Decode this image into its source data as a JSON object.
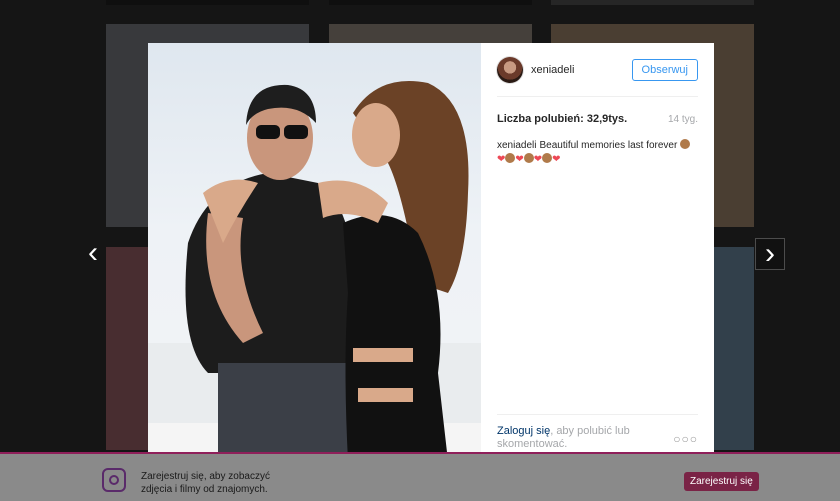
{
  "modal": {
    "username": "xeniadeli",
    "follow_label": "Obserwuj",
    "likes_label": "Liczba polubień: 32,9tys.",
    "time_label": "14 tyg.",
    "caption_user": "xeniadeli",
    "caption_text": "Beautiful memories last forever",
    "caption_emojis": [
      "see-no-evil-monkey",
      "heart",
      "see-no-evil-monkey",
      "heart",
      "see-no-evil-monkey",
      "heart",
      "see-no-evil-monkey",
      "heart"
    ],
    "login_link": "Zaloguj się",
    "login_rest": ", aby polubić lub skomentować.",
    "more_label": "○○○"
  },
  "nav": {
    "prev_icon": "chevron-left-icon",
    "next_icon": "chevron-right-icon"
  },
  "bottom_bar": {
    "signup_link": "Zarejestruj się",
    "text_rest_line1": ", aby zobaczyć",
    "text_line2": "zdjęcia i filmy od znajomych.",
    "button_label": "Zarejestruj się"
  },
  "colors": {
    "accent_blue": "#3897f0",
    "link_dark": "#003569",
    "signup_button": "#7a2346"
  }
}
